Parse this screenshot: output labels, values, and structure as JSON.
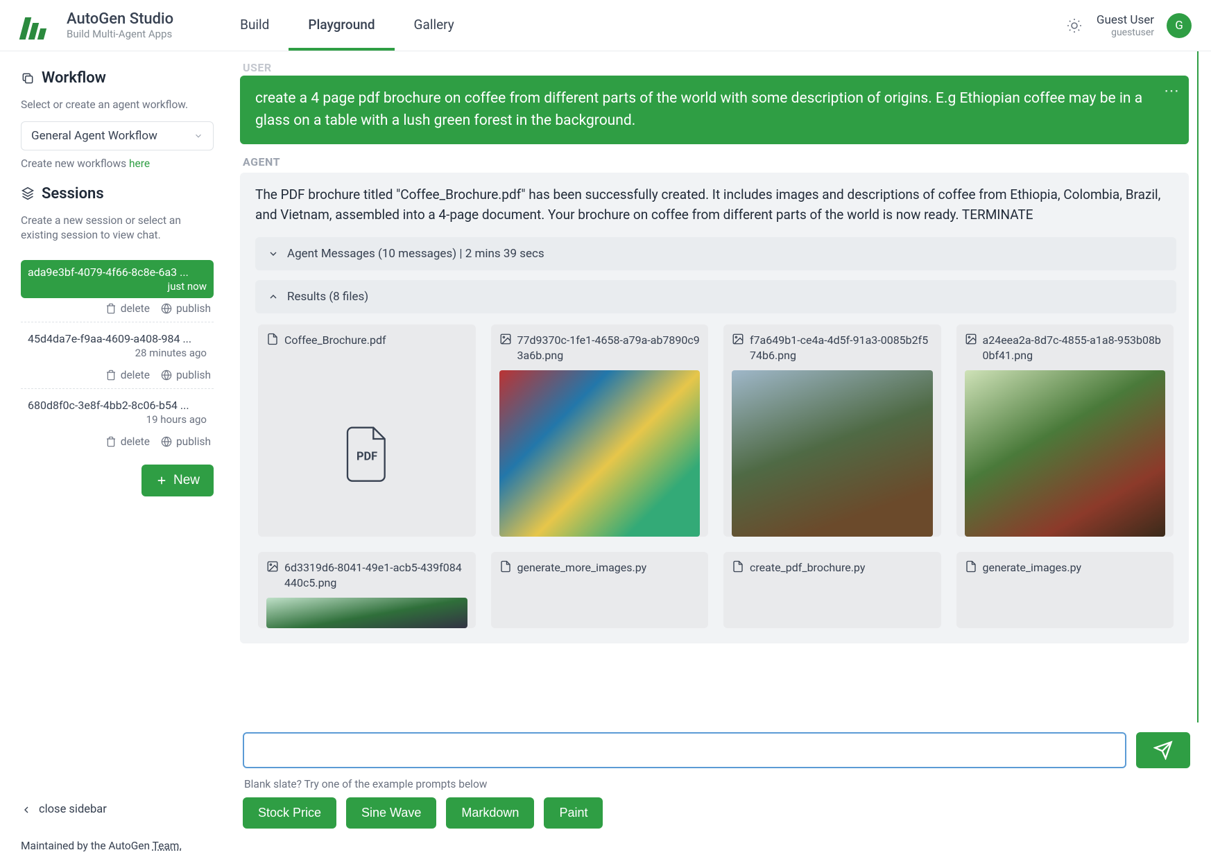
{
  "brand": {
    "title": "AutoGen Studio",
    "subtitle": "Build Multi-Agent Apps"
  },
  "nav": {
    "tabs": [
      "Build",
      "Playground",
      "Gallery"
    ],
    "active": "Playground"
  },
  "user": {
    "name": "Guest User",
    "handle": "guestuser",
    "initial": "G"
  },
  "sidebar": {
    "workflow_title": "Workflow",
    "workflow_desc": "Select or create an agent workflow.",
    "workflow_selected": "General Agent Workflow",
    "create_wf_text": "Create new workflows ",
    "create_wf_link": "here",
    "sessions_title": "Sessions",
    "sessions_desc": "Create a new session or select an existing session to view chat.",
    "sessions": [
      {
        "id": "ada9e3bf-4079-4f66-8c8e-6a3 ...",
        "time": "just now",
        "active": true
      },
      {
        "id": "45d4da7e-f9aa-4609-a408-984 ...",
        "time": "28 minutes ago",
        "active": false
      },
      {
        "id": "680d8f0c-3e8f-4bb2-8c06-b54 ...",
        "time": "19 hours ago",
        "active": false
      }
    ],
    "action_delete": "delete",
    "action_publish": "publish",
    "new_label": "New",
    "close_label": "close sidebar"
  },
  "chat": {
    "user_label": "USER",
    "agent_label": "AGENT",
    "user_message": "create a 4 page pdf brochure on coffee from different parts of the world with some description of origins. E.g Ethiopian coffee may be in a glass on a table with a lush green forest in the background.",
    "agent_message": "The PDF brochure titled \"Coffee_Brochure.pdf\" has been successfully created. It includes images and descriptions of coffee from Ethiopia, Colombia, Brazil, and Vietnam, assembled into a 4-page document. Your brochure on coffee from different parts of the world is now ready. TERMINATE",
    "collapse_messages": "Agent Messages (10 messages) | 2 mins 39 secs",
    "collapse_results": "Results (8 files)",
    "files": [
      {
        "name": "Coffee_Brochure.pdf",
        "type": "pdf"
      },
      {
        "name": "77d9370c-1fe1-4658-a79a-ab7890c93a6b.png",
        "type": "img",
        "thumb": "t1"
      },
      {
        "name": "f7a649b1-ce4a-4d5f-91a3-0085b2f574b6.png",
        "type": "img",
        "thumb": "t2"
      },
      {
        "name": "a24eea2a-8d7c-4855-a1a8-953b08b0bf41.png",
        "type": "img",
        "thumb": "t3"
      },
      {
        "name": "6d3319d6-8041-49e1-acb5-439f084440c5.png",
        "type": "img",
        "thumb": "t4"
      },
      {
        "name": "generate_more_images.py",
        "type": "file"
      },
      {
        "name": "create_pdf_brochure.py",
        "type": "file"
      },
      {
        "name": "generate_images.py",
        "type": "file"
      }
    ]
  },
  "composer": {
    "placeholder": "",
    "hint": "Blank slate? Try one of the example prompts below",
    "suggestions": [
      "Stock Price",
      "Sine Wave",
      "Markdown",
      "Paint"
    ]
  },
  "footer": {
    "text": "Maintained by the AutoGen ",
    "team": "Team."
  }
}
